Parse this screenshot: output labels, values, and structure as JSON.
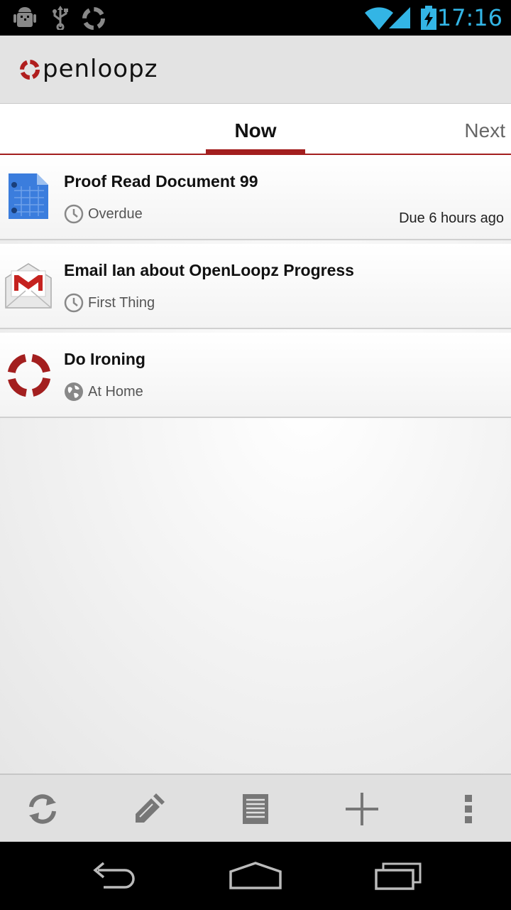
{
  "status_bar": {
    "time": "17:16",
    "icons": [
      "android-debug-icon",
      "usb-icon",
      "sync-loop-icon",
      "wifi-icon",
      "signal-icon",
      "battery-charging-icon"
    ]
  },
  "app": {
    "logo_text": "openloopz",
    "brand_color": "#a31f1f"
  },
  "tabs": {
    "active": "Now",
    "next": "Next"
  },
  "tasks": [
    {
      "title": "Proof Read Document 99",
      "icon": "google-docs-icon",
      "meta_icon": "clock-icon",
      "meta": "Overdue",
      "due": "Due 6 hours ago"
    },
    {
      "title": "Email Ian about OpenLoopz Progress",
      "icon": "gmail-icon",
      "meta_icon": "clock-icon",
      "meta": "First Thing",
      "due": ""
    },
    {
      "title": "Do Ironing",
      "icon": "openloopz-icon",
      "meta_icon": "globe-icon",
      "meta": "At Home",
      "due": ""
    }
  ],
  "actions": [
    "refresh-icon",
    "edit-icon",
    "list-icon",
    "add-icon",
    "overflow-menu-icon"
  ],
  "nav": [
    "back-icon",
    "home-icon",
    "recents-icon"
  ]
}
